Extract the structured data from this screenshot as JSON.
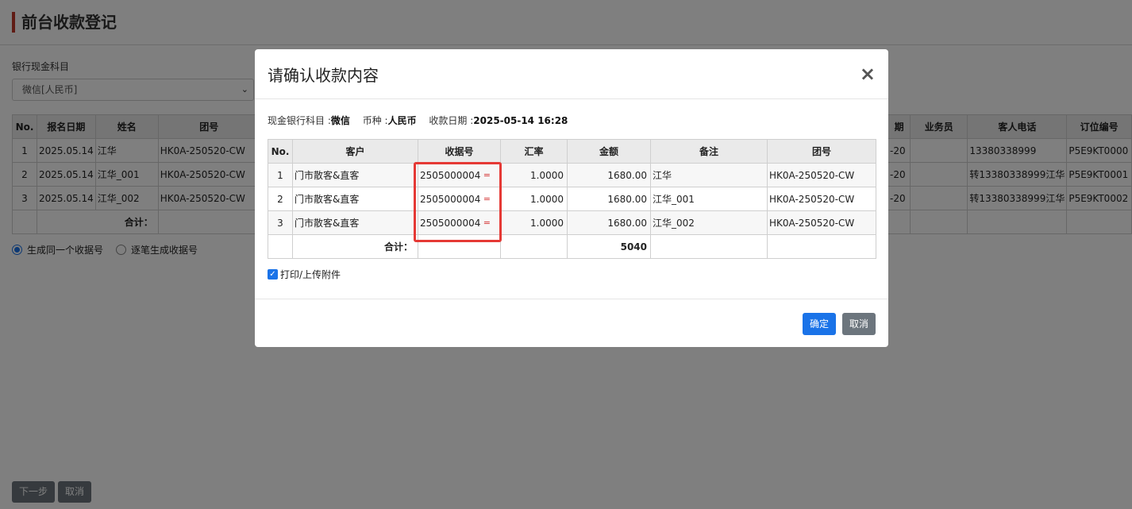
{
  "page": {
    "title": "前台收款登记",
    "account_label": "银行现金科目",
    "account_value": "微信[人民币]",
    "table_headers_left": [
      "No.",
      "报名日期",
      "姓名",
      "团号"
    ],
    "table_headers_right": [
      "期",
      "业务员",
      "客人电话",
      "订位编号"
    ],
    "rows": [
      {
        "no": "1",
        "date": "2025.05.14",
        "name": "江华",
        "group": "HK0A-250520-CW",
        "date_tail": "-20",
        "staff": "",
        "phone": "13380338999",
        "booking": "P5E9KT0000"
      },
      {
        "no": "2",
        "date": "2025.05.14",
        "name": "江华_001",
        "group": "HK0A-250520-CW",
        "date_tail": "-20",
        "staff": "",
        "phone": "转13380338999江华",
        "booking": "P5E9KT0001"
      },
      {
        "no": "3",
        "date": "2025.05.14",
        "name": "江华_002",
        "group": "HK0A-250520-CW",
        "date_tail": "-20",
        "staff": "",
        "phone": "转13380338999江华",
        "booking": "P5E9KT0002"
      }
    ],
    "sum_label": "合计：",
    "radio_same": "生成同一个收据号",
    "radio_each": "逐笔生成收据号",
    "next_button": "下一步",
    "cancel_button": "取消"
  },
  "modal": {
    "title": "请确认收款内容",
    "close": "×",
    "info": {
      "account_label": "现金银行科目 :",
      "account_value": "微信",
      "currency_label": "币种 :",
      "currency_value": "人民币",
      "date_label": "收款日期 :",
      "date_value": "2025-05-14 16:28"
    },
    "headers": [
      "No.",
      "客户",
      "收据号",
      "汇率",
      "金额",
      "备注",
      "团号"
    ],
    "rows": [
      {
        "no": "1",
        "customer": "门市散客&直客",
        "receipt": "2505000004",
        "eq": "=",
        "rate": "1.0000",
        "amount": "1680.00",
        "note": "江华",
        "group": "HK0A-250520-CW"
      },
      {
        "no": "2",
        "customer": "门市散客&直客",
        "receipt": "2505000004",
        "eq": "=",
        "rate": "1.0000",
        "amount": "1680.00",
        "note": "江华_001",
        "group": "HK0A-250520-CW"
      },
      {
        "no": "3",
        "customer": "门市散客&直客",
        "receipt": "2505000004",
        "eq": "=",
        "rate": "1.0000",
        "amount": "1680.00",
        "note": "江华_002",
        "group": "HK0A-250520-CW"
      }
    ],
    "sum_label": "合计：",
    "sum_value": "5040",
    "checkbox_label": "打印/上传附件",
    "confirm_button": "确定",
    "cancel_button": "取消"
  },
  "colors": {
    "primary": "#1a73e8",
    "secondary": "#6c757d",
    "title_accent": "#c0392b",
    "highlight": "#e53935"
  }
}
